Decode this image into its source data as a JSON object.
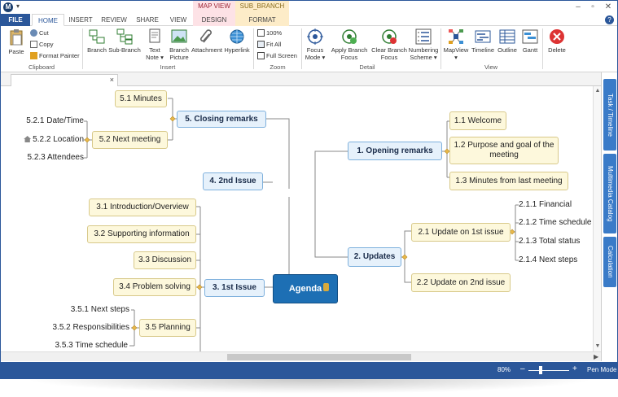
{
  "window": {
    "context_groups": [
      "MAP VIEW",
      "SUB_BRANCH"
    ]
  },
  "tabs": [
    "FILE",
    "HOME",
    "INSERT",
    "REVIEW",
    "SHARE",
    "VIEW",
    "DESIGN",
    "FORMAT"
  ],
  "ribbon": {
    "clipboard": {
      "label": "Clipboard",
      "paste": "Paste",
      "cut": "Cut",
      "copy": "Copy",
      "format_painter": "Format Painter"
    },
    "insert": {
      "label": "Insert",
      "branch": "Branch",
      "sub_branch": "Sub-Branch",
      "text_note": "Text Note",
      "branch_picture": "Branch Picture",
      "attachment": "Attachment",
      "hyperlink": "Hyperlink"
    },
    "zoom": {
      "label": "Zoom",
      "pct100": "100%",
      "fit_all": "Fit All",
      "full_screen": "Full Screen"
    },
    "detail": {
      "label": "Detail",
      "focus_mode": "Focus Mode",
      "apply_branch_focus": "Apply Branch Focus",
      "clear_branch_focus": "Clear Branch Focus",
      "numbering_scheme": "Numbering Scheme"
    },
    "view": {
      "label": "View",
      "mapview": "MapView",
      "timeline": "Timeline",
      "outline": "Outline",
      "gantt": "Gantt"
    },
    "delete": "Delete"
  },
  "side_tabs": [
    "Task / Timeline",
    "Multimedia Catalog",
    "Calculation"
  ],
  "status": {
    "zoom": "80%",
    "pen_mode": "Pen Mode"
  },
  "map": {
    "center": "Agenda",
    "closing": {
      "title": "5.  Closing remarks",
      "minutes": "5.1 Minutes",
      "next_meeting": "5.2 Next meeting",
      "date_time": "5.2.1 Date/Time",
      "location": "5.2.2 Location",
      "attendees": "5.2.3 Attendees"
    },
    "second_issue": "4.  2nd Issue",
    "first_issue": {
      "title": "3.  1st Issue",
      "intro": "3.1 Introduction/Overview",
      "supporting": "3.2 Supporting information",
      "discussion": "3.3 Discussion",
      "problem": "3.4 Problem solving",
      "planning": "3.5 Planning",
      "next_steps": "3.5.1 Next steps",
      "responsibilities": "3.5.2 Responsibilities",
      "time_schedule": "3.5.3 Time schedule"
    },
    "opening": {
      "title": "1.  Opening remarks",
      "welcome": "1.1 Welcome",
      "purpose_line1": "1.2  Purpose and goal of the",
      "purpose_line2": "meeting",
      "minutes": "1.3 Minutes from last meeting"
    },
    "updates": {
      "title": "2.  Updates",
      "first": "2.1 Update on 1st issue",
      "second": "2.2 Update on 2nd issue",
      "financial": "2.1.1 Financial",
      "time_schedule": "2.1.2 Time schedule",
      "total_status": "2.1.3 Total status",
      "next_steps": "2.1.4 Next steps"
    }
  }
}
